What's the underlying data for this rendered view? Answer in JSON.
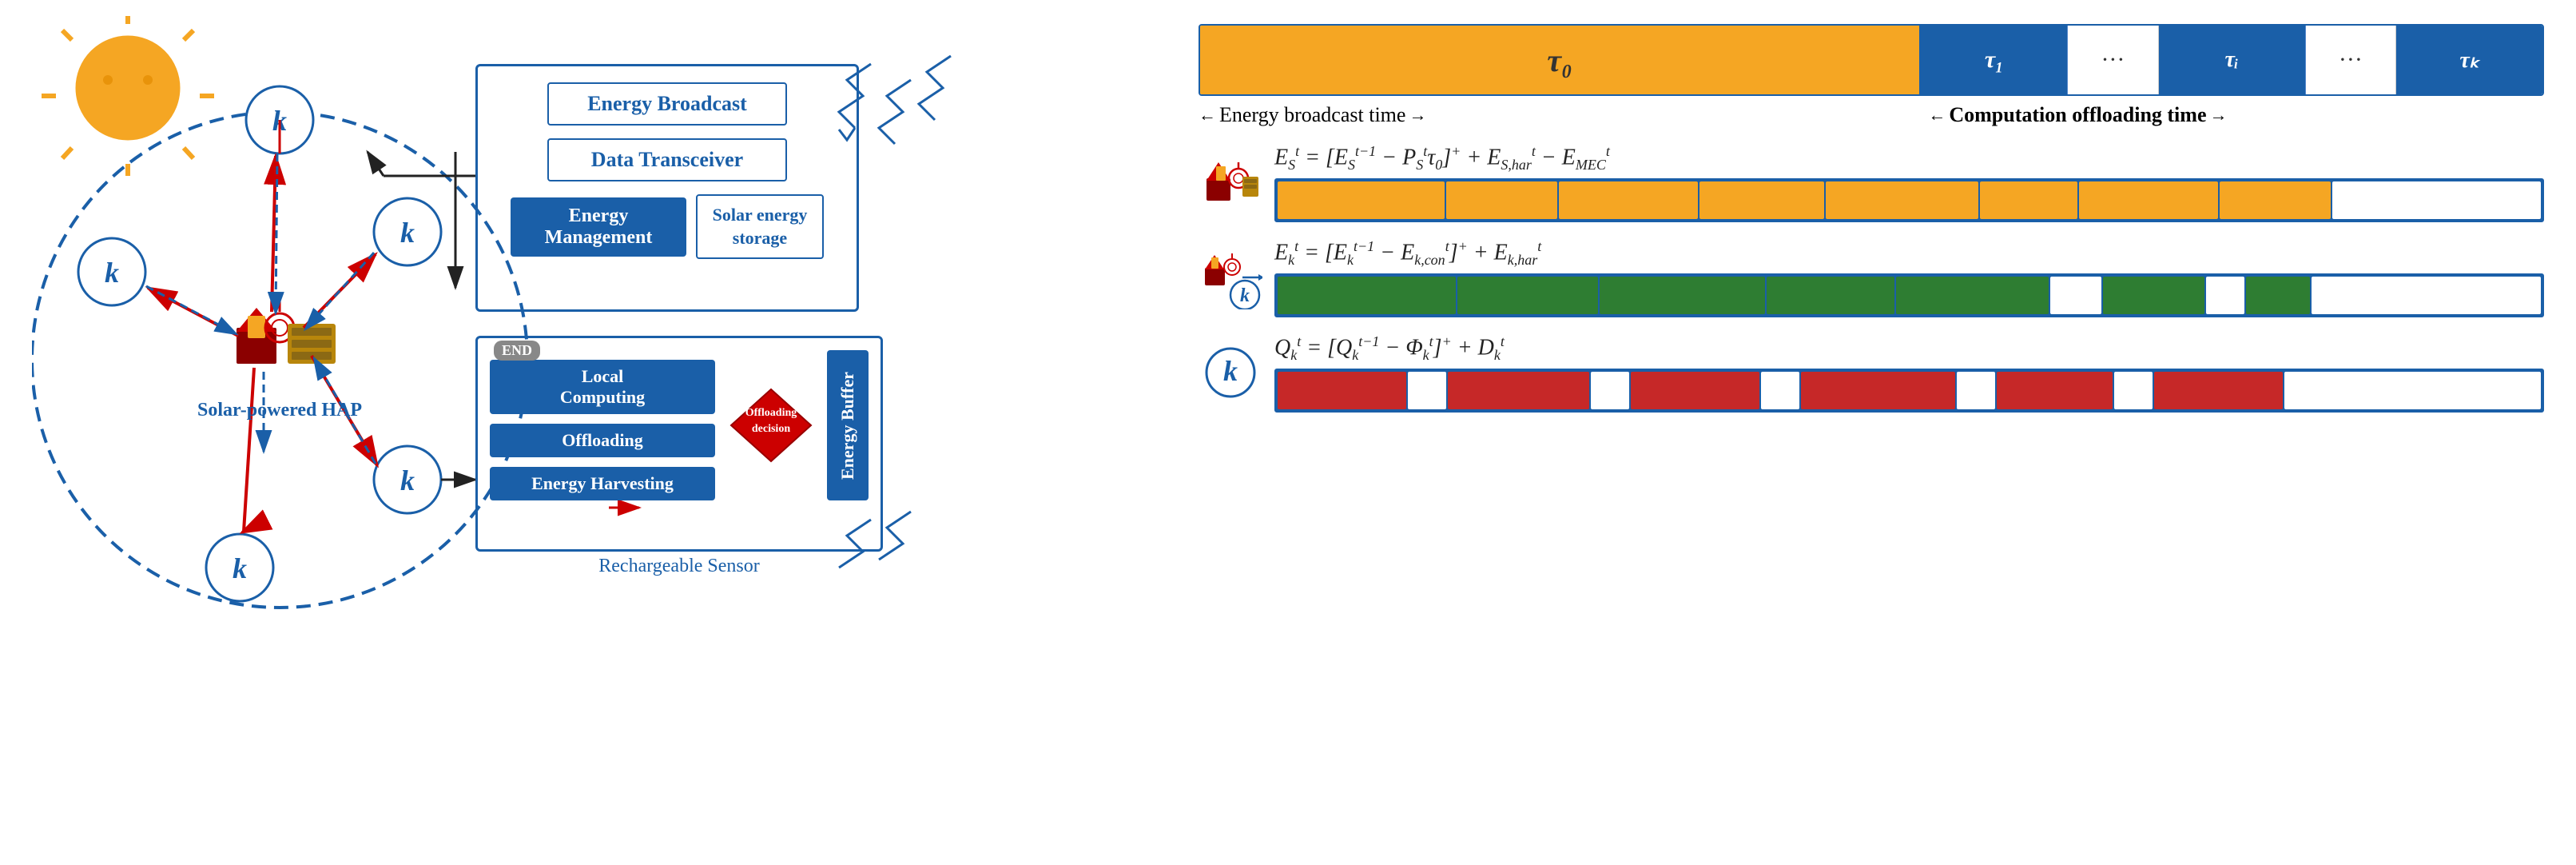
{
  "diagram": {
    "title": "Solar-powered HAP",
    "sensor_label": "Rechargeable Sensor",
    "hap_label": "Solar-powered HAP",
    "nodes": {
      "k_label": "k"
    },
    "hap_system": {
      "energy_broadcast": "Energy Broadcast",
      "data_transceiver": "Data Transceiver",
      "energy_management": "Energy Management",
      "solar_storage": "Solar energy storage"
    },
    "sensor_system": {
      "local_computing": "Local Computing",
      "offloading": "Offloading",
      "energy_harvesting": "Energy Harvesting",
      "energy_buffer": "Energy Buffer",
      "end_label": "END",
      "offloading_decision": "Offloading decision"
    }
  },
  "timeline": {
    "tau0_label": "τ₀",
    "tau1_label": "τ₁",
    "taui_label": "τᵢ",
    "tauk_label": "τₖ",
    "dots": "···",
    "broadcast_label": "Energy broadcast time",
    "computation_label": "Computation offloading time"
  },
  "equations": {
    "eq1": "E",
    "eq1_full": "E_S^t = [E_S^{t-1} - P_S^t τ_0]^+ + E_{S,har}^t - E_{MEC}^t",
    "eq2_full": "E_k^t = [E_k^{t-1} - E_{k,con}^t]^+ + E_{k,har}^t",
    "eq3_full": "Q_k^t = [Q_k^{t-1} - Φ_k^t]^+ + D_k^t"
  },
  "colors": {
    "blue": "#1a5fa8",
    "gold": "#f5a623",
    "red": "#c62828",
    "green": "#2e7d32",
    "dark_red": "#8b0000",
    "white": "#ffffff"
  }
}
